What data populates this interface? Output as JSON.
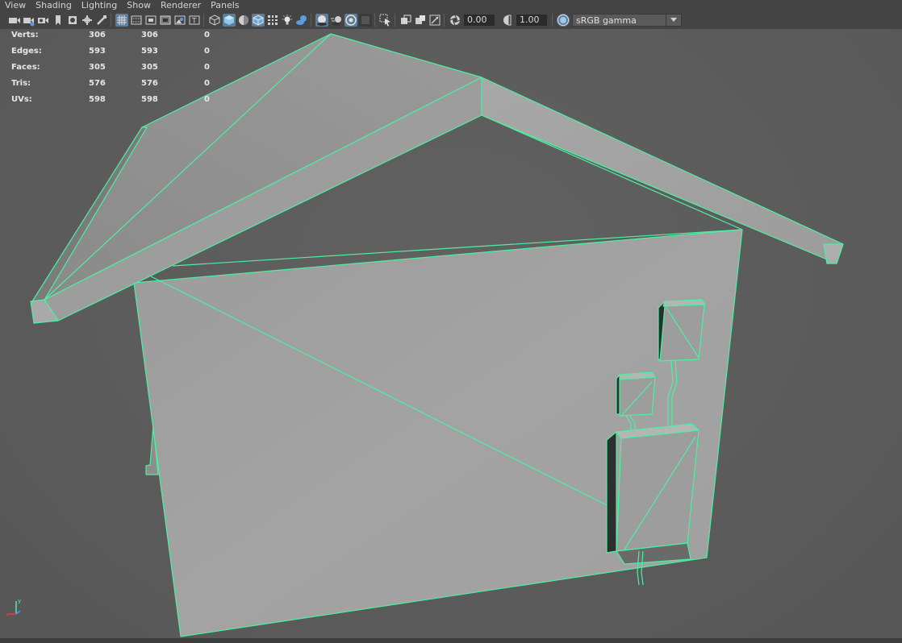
{
  "menu": [
    "View",
    "Shading",
    "Lighting",
    "Show",
    "Renderer",
    "Panels"
  ],
  "toolbar": {
    "exposure": "0.00",
    "gamma": "1.00",
    "color_space": "sRGB gamma"
  },
  "hud": {
    "rows": [
      {
        "label": "Verts:",
        "v1": "306",
        "v2": "306",
        "v3": "0"
      },
      {
        "label": "Edges:",
        "v1": "593",
        "v2": "593",
        "v3": "0"
      },
      {
        "label": "Faces:",
        "v1": "305",
        "v2": "305",
        "v3": "0"
      },
      {
        "label": "Tris:",
        "v1": "576",
        "v2": "576",
        "v3": "0"
      },
      {
        "label": "UVs:",
        "v1": "598",
        "v2": "598",
        "v3": "0"
      }
    ]
  },
  "icons": [
    "camera-icon",
    "camera-attributes-icon",
    "bookmark-icon",
    "image-plane-icon",
    "grid-icon",
    "film-gate-icon",
    "resolution-gate-icon",
    "gate-mask-icon",
    "field-chart-icon",
    "safe-action-icon",
    "safe-title-icon",
    "wireframe-icon",
    "smooth-shade-icon",
    "default-material-icon",
    "wireframe-on-shaded-icon",
    "xray-icon",
    "use-lights-icon",
    "shadows-icon",
    "screen-space-ao-icon",
    "motion-blur-icon",
    "anti-aliasing-icon",
    "depth-of-field-icon",
    "isolate-select-icon",
    "xray-joints-icon",
    "xray-active-icon",
    "backface-culling-icon",
    "exposure-icon",
    "gamma-icon",
    "color-management-icon"
  ],
  "colors": {
    "wire_highlight": "#4cf0a0",
    "menu_bg": "#444444",
    "viewport_bg": "#5c5c5c",
    "active_button": "#5d7d99"
  }
}
